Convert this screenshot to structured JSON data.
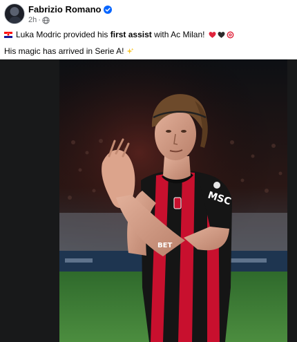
{
  "post": {
    "author": "Fabrizio Romano",
    "time": "2h",
    "line1_before": "Luka Modric provided his ",
    "line1_bold": "first assist",
    "line1_after": " with Ac Milan!",
    "line2": "His magic has arrived in Serie A!"
  },
  "photo": {
    "shirt_sponsor": "MSC",
    "shirt_name": "BET"
  },
  "icons": {
    "flag": "croatia-flag-icon",
    "verified": "verified-badge-icon",
    "audience": "globe-icon",
    "emojis": [
      "red-heart-icon",
      "black-heart-icon",
      "bullseye-icon",
      "sparkles-icon"
    ]
  },
  "colors": {
    "verified_blue": "#0866ff",
    "milan_red": "#c8102e",
    "milan_black": "#111111",
    "pitch_green": "#3f7d36",
    "secondary_text": "#65676b"
  }
}
